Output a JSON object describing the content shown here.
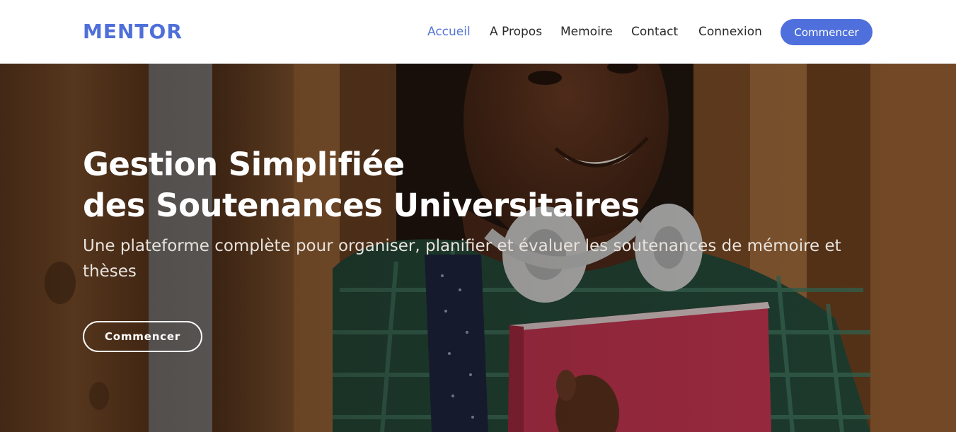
{
  "brand": {
    "name": "MENTOR",
    "color": "#4f6fd9"
  },
  "nav": {
    "items": [
      {
        "label": "Accueil",
        "active": true
      },
      {
        "label": "A Propos",
        "active": false
      },
      {
        "label": "Memoire",
        "active": false
      },
      {
        "label": "Contact",
        "active": false
      },
      {
        "label": "Connexion",
        "active": false
      }
    ],
    "active_color": "#5676d6",
    "cta_label": "Commencer",
    "cta_color": "#4f70dc"
  },
  "hero": {
    "title_line1": "Gestion Simplifiée",
    "title_line2": "des Soutenances Universitaires",
    "subtitle": "Une plateforme complète pour organiser, planifier et évaluer les soutenances de mémoire et thèses",
    "cta_label": "Commencer",
    "background": "photo-student-holding-book-icon"
  }
}
